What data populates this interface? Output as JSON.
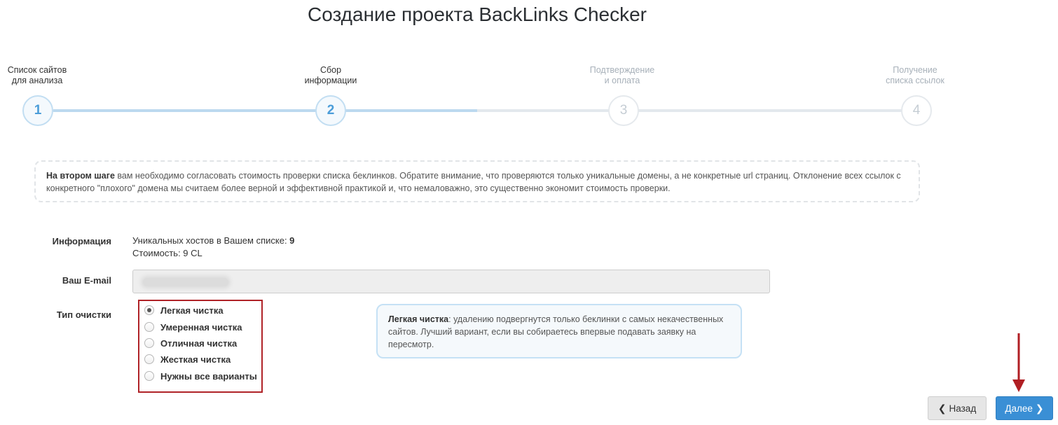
{
  "page": {
    "title": "Создание проекта BackLinks Checker"
  },
  "wizard": {
    "steps": [
      {
        "number": "1",
        "label": "Список сайтов\nдля анализа",
        "state": "done"
      },
      {
        "number": "2",
        "label": "Сбор\nинформации",
        "state": "current"
      },
      {
        "number": "3",
        "label": "Подтверждение\nи оплата",
        "state": "upcoming"
      },
      {
        "number": "4",
        "label": "Получение\nсписка ссылок",
        "state": "upcoming"
      }
    ]
  },
  "note": {
    "bold": "На втором шаге",
    "text": " вам необходимо согласовать стоимость проверки списка беклинков. Обратите внимание, что проверяются только уникальные домены, а не конкретные url страниц. Отклонение всех ссылок с конкретного \"плохого\" домена мы считаем более верной и эффективной практикой и, что немаловажно, это существенно экономит стоимость проверки."
  },
  "form": {
    "info": {
      "label": "Информация",
      "hosts_prefix": "Уникальных хостов в Вашем списке: ",
      "hosts_value": "9",
      "cost": "Стоимость: 9 CL"
    },
    "email": {
      "label": "Ваш E-mail",
      "value": ""
    },
    "cleaning": {
      "label": "Тип очистки",
      "options": [
        {
          "label": "Легкая чистка",
          "checked": true
        },
        {
          "label": "Умеренная чистка",
          "checked": false
        },
        {
          "label": "Отличная чистка",
          "checked": false
        },
        {
          "label": "Жесткая чистка",
          "checked": false
        },
        {
          "label": "Нужны все варианты",
          "checked": false
        }
      ],
      "tip_bold": "Легкая чистка",
      "tip_text": ": удалению подвергнутся только беклинки с самых некачественных сайтов. Лучший вариант, если вы собираетесь впервые подавать заявку на пересмотр."
    }
  },
  "buttons": {
    "back": "Назад",
    "next": "Далее"
  },
  "colors": {
    "accent": "#3a8fd5",
    "highlight_border": "#b02328",
    "annotation_arrow": "#b01e23"
  }
}
